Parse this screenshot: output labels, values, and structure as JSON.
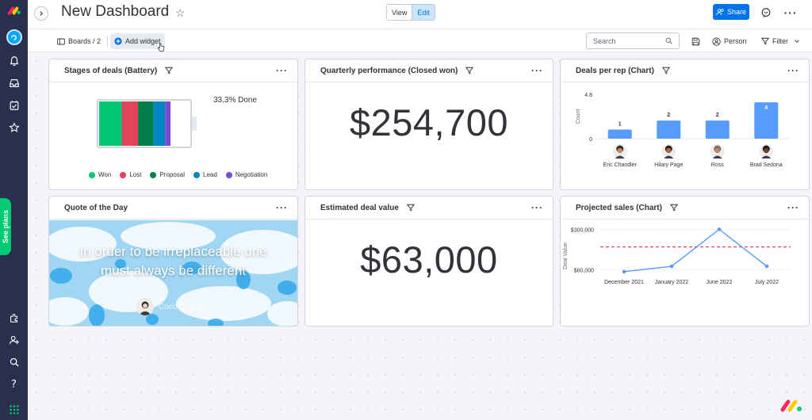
{
  "header": {
    "title": "New Dashboard",
    "view_label": "View",
    "edit_label": "Edit",
    "share_label": "Share"
  },
  "rail": {
    "see_plans_label": "See plans"
  },
  "toolbar": {
    "boards_label": "Boards / 2",
    "add_widget_label": "Add widget",
    "search_placeholder": "Search",
    "person_label": "Person",
    "filter_label": "Filter"
  },
  "widgets": {
    "battery": {
      "title": "Stages of deals (Battery)",
      "done_text": "33.3% Done",
      "legend": [
        "Won",
        "Lost",
        "Proposal",
        "Lead",
        "Negotiation"
      ],
      "colors": [
        "#00c875",
        "#e2445c",
        "#037f4c",
        "#0086c0",
        "#784bd1"
      ],
      "segments": [
        0.25,
        0.18,
        0.17,
        0.13,
        0.06
      ]
    },
    "quarterly": {
      "title": "Quarterly performance (Closed won)",
      "value": "$254,700"
    },
    "deals_per_rep": {
      "title": "Deals per rep (Chart)"
    },
    "quote": {
      "title": "Quote of the Day",
      "line1": "In order to be irreplaceable one",
      "line2": "must always be different",
      "author": "Coco Chanel"
    },
    "estimated": {
      "title": "Estimated deal value",
      "value": "$63,000"
    },
    "projected": {
      "title": "Projected sales (Chart)"
    }
  },
  "chart_data": [
    {
      "type": "bar",
      "title": "Deals per rep (Chart)",
      "categories": [
        "Eric Chandler",
        "Hilary Page",
        "Ross",
        "Brad Sedona"
      ],
      "values": [
        1,
        2,
        2,
        4
      ],
      "data_labels": [
        "1",
        "2",
        "2",
        "4"
      ],
      "ylabel": "Count",
      "ytick_labels": [
        "0",
        "4.8"
      ],
      "ylim": [
        0,
        4.8
      ],
      "color": "#579bfc"
    },
    {
      "type": "line",
      "title": "Projected sales (Chart)",
      "categories": [
        "December 2021",
        "January 2022",
        "June 2022",
        "July 2022"
      ],
      "values": [
        48000,
        80000,
        300000,
        80000
      ],
      "ylabel": "Deal Value",
      "ytick_labels": [
        "$300,000",
        "$60,000"
      ],
      "ylim": [
        0,
        330000
      ],
      "reference_line": 195000,
      "color": "#579bfc",
      "reference_color": "#e2445c"
    }
  ]
}
